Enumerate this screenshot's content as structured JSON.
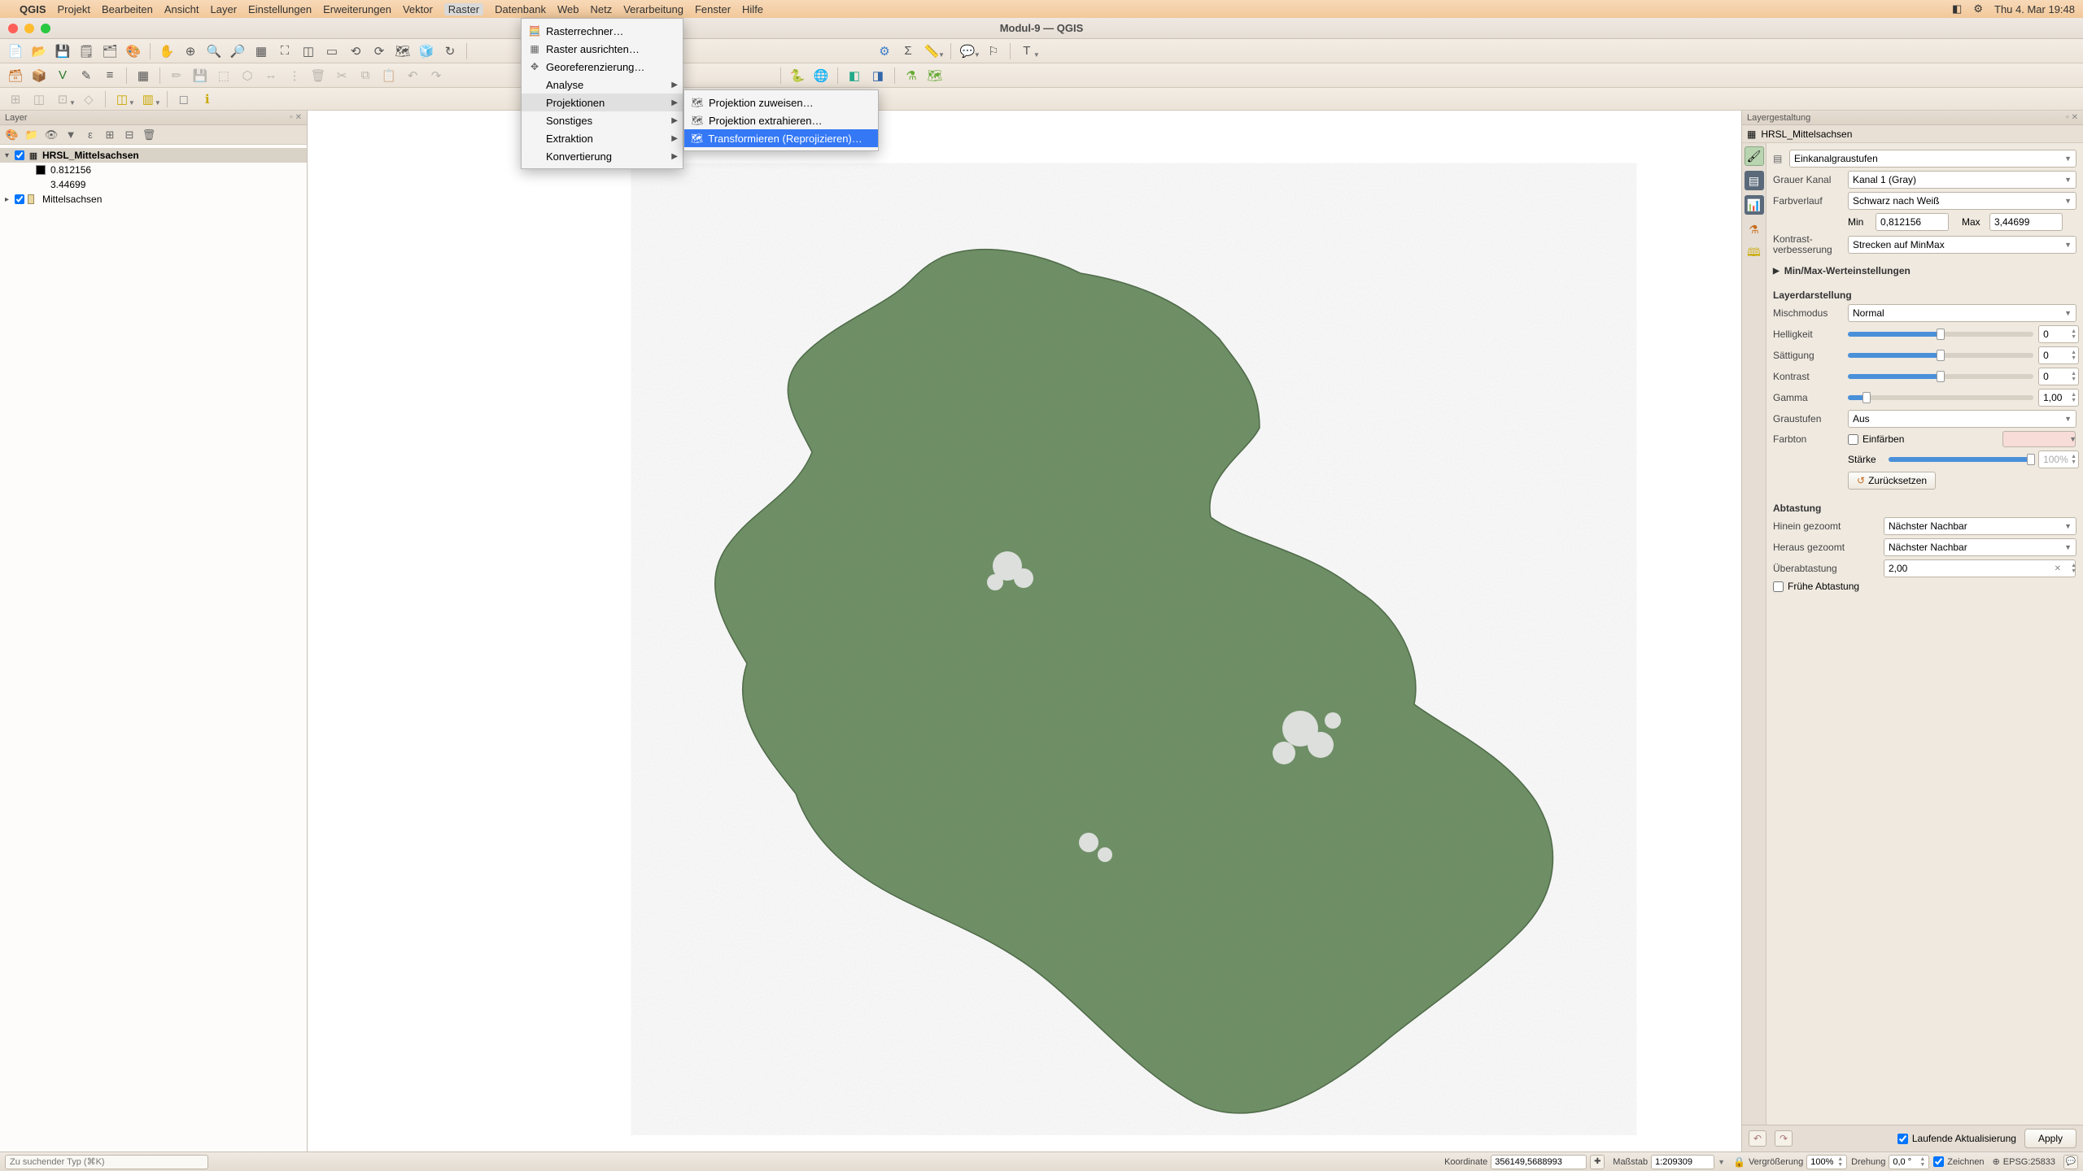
{
  "menubar": {
    "app": "QGIS",
    "items": [
      "Projekt",
      "Bearbeiten",
      "Ansicht",
      "Layer",
      "Einstellungen",
      "Erweiterungen",
      "Vektor",
      "Raster",
      "Datenbank",
      "Web",
      "Netz",
      "Verarbeitung",
      "Fenster",
      "Hilfe"
    ],
    "active_index": 7,
    "clock": "Thu 4. Mar  19:48"
  },
  "window": {
    "title": "Modul-9 — QGIS"
  },
  "raster_menu": {
    "items": [
      {
        "icon": "🧮",
        "label": "Rasterrechner…"
      },
      {
        "icon": "▦",
        "label": "Raster ausrichten…"
      },
      {
        "icon": "✥",
        "label": "Georeferenzierung…"
      },
      {
        "icon": "",
        "label": "Analyse",
        "sub": true
      },
      {
        "icon": "",
        "label": "Projektionen",
        "sub": true
      },
      {
        "icon": "",
        "label": "Sonstiges",
        "sub": true
      },
      {
        "icon": "",
        "label": "Extraktion",
        "sub": true
      },
      {
        "icon": "",
        "label": "Konvertierung",
        "sub": true
      }
    ],
    "highlight_index": 4
  },
  "proj_submenu": {
    "items": [
      {
        "icon": "🗺",
        "label": "Projektion zuweisen…"
      },
      {
        "icon": "🗺",
        "label": "Projektion extrahieren…"
      },
      {
        "icon": "🗺",
        "label": "Transformieren (Reprojizieren)…"
      }
    ],
    "highlight_index": 2
  },
  "layers": {
    "title": "Layer",
    "items": [
      {
        "name": "HRSL_Mittelsachsen",
        "checked": true,
        "expanded": true,
        "bold": true,
        "type": "raster",
        "sub": [
          {
            "swatch": "black",
            "label": "0.812156"
          },
          {
            "swatch": "",
            "label": "3.44699"
          }
        ]
      },
      {
        "name": "Mittelsachsen",
        "checked": true,
        "expanded": false,
        "type": "polygon"
      }
    ]
  },
  "style": {
    "title": "Layergestaltung",
    "layer_name": "HRSL_Mittelsachsen",
    "renderer": "Einkanalgraustufen",
    "gray_channel_label": "Grauer Kanal",
    "gray_channel": "Kanal 1 (Gray)",
    "gradient_label": "Farbverlauf",
    "gradient": "Schwarz nach Weiß",
    "min_label": "Min",
    "min": "0,812156",
    "max_label": "Max",
    "max": "3,44699",
    "contrast_label": "Kontrast-\nverbesserung",
    "contrast": "Strecken auf MinMax",
    "minmax_section": "Min/Max-Werteinstellungen",
    "rendering_section": "Layerdarstellung",
    "blend_label": "Mischmodus",
    "blend": "Normal",
    "brightness_label": "Helligkeit",
    "brightness": "0",
    "saturation_label": "Sättigung",
    "saturation": "0",
    "contrast2_label": "Kontrast",
    "contrast2": "0",
    "gamma_label": "Gamma",
    "gamma": "1,00",
    "grayscale_label": "Graustufen",
    "grayscale": "Aus",
    "colorize_label": "Einfärben",
    "hue_label": "Farbton",
    "strength_label": "Stärke",
    "strength": "100%",
    "reset_label": "Zurücksetzen",
    "resampling_section": "Abtastung",
    "zoom_in_label": "Hinein gezoomt",
    "zoom_in": "Nächster Nachbar",
    "zoom_out_label": "Heraus gezoomt",
    "zoom_out": "Nächster Nachbar",
    "oversampling_label": "Überabtastung",
    "oversampling": "2,00",
    "early_label": "Frühe Abtastung",
    "live_label": "Laufende Aktualisierung",
    "apply": "Apply"
  },
  "statusbar": {
    "search_placeholder": "Zu suchender Typ (⌘K)",
    "coord_label": "Koordinate",
    "coord": "356149,5688993",
    "scale_label": "Maßstab",
    "scale": "1:209309",
    "mag_label": "Vergrößerung",
    "mag": "100%",
    "rot_label": "Drehung",
    "rot": "0,0 °",
    "render_label": "Zeichnen",
    "crs": "EPSG:25833"
  }
}
